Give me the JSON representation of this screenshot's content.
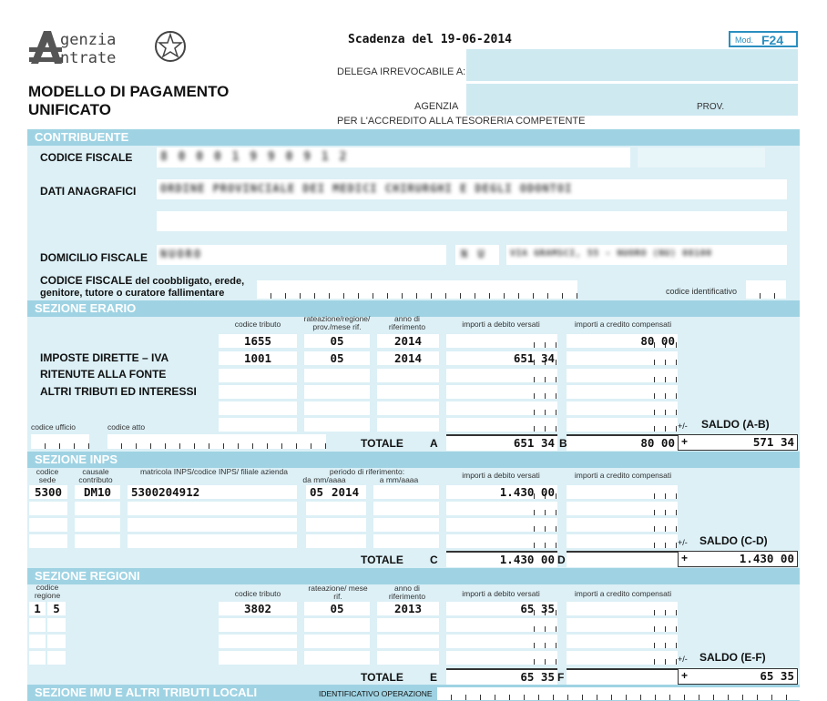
{
  "header": {
    "logo_line1": "genzia",
    "logo_line2": "ntrate",
    "scadenza": "Scadenza del 19-06-2014",
    "mod_label": "Mod.",
    "mod_code": "F24",
    "title_line1": "MODELLO DI PAGAMENTO",
    "title_line2": "UNIFICATO",
    "delega_label": "DELEGA IRREVOCABILE A:",
    "agenzia_label": "AGENZIA",
    "prov_label": "PROV.",
    "accredito_label": "PER L'ACCREDITO ALLA TESORERIA COMPETENTE"
  },
  "contribuente": {
    "band": "CONTRIBUENTE",
    "codice_fiscale_label": "CODICE FISCALE",
    "codice_fiscale_value": "8 0 0 0 1 9 9 0 9 1 2",
    "dati_anagrafici_label": "DATI ANAGRAFICI",
    "ragione_sociale": "ORDINE PROVINCIALE DEI MEDICI CHIRURGHI E DEGLI ODONTOI",
    "domicilio_label": "DOMICILIO FISCALE",
    "comune": "NUORO",
    "provincia": "N U",
    "indirizzo": "VIA GRAMSCI, 55 - NUORO (NU) 08100",
    "coobbligato_label_bold": "CODICE FISCALE",
    "coobbligato_label_rest": " del coobbligato, erede,",
    "coobbligato_label_line2": "genitore, tutore o curatore fallimentare",
    "codice_identificativo": "codice identificativo"
  },
  "erario": {
    "band": "SEZIONE ERARIO",
    "headers": {
      "codice_tributo": "codice tributo",
      "rateazione": "rateazione/regione/ prov./mese rif.",
      "anno": "anno di riferimento",
      "debito": "importi a debito versati",
      "credito": "importi a credito compensati"
    },
    "left_labels": [
      "IMPOSTE DIRETTE – IVA",
      "RITENUTE ALLA FONTE",
      "ALTRI TRIBUTI ED INTERESSI"
    ],
    "rows": [
      {
        "codice": "1655",
        "rateazione": "05",
        "anno": "2014",
        "debito": "",
        "credito": "80 00"
      },
      {
        "codice": "1001",
        "rateazione": "05",
        "anno": "2014",
        "debito": "651 34",
        "credito": ""
      }
    ],
    "codice_ufficio": "codice ufficio",
    "codice_atto": "codice atto",
    "totale_label": "TOTALE",
    "totale_a_letter": "A",
    "totale_a": "651 34",
    "totale_b_letter": "B",
    "totale_b": "80 00",
    "saldo_label": "SALDO (A-B)",
    "saldo": "571 34"
  },
  "inps": {
    "band": "SEZIONE INPS",
    "headers": {
      "codice_sede": "codice sede",
      "causale": "causale contributo",
      "matricola": "matricola INPS/codice INPS/ filiale azienda",
      "periodo": "periodo di riferimento:",
      "da": "da mm/aaaa",
      "a": "a mm/aaaa",
      "debito": "importi a debito versati",
      "credito": "importi a credito compensati"
    },
    "row": {
      "sede": "5300",
      "causale": "DM10",
      "matricola": "5300204912",
      "da_mm": "05",
      "da_aaaa": "2014",
      "debito": "1.430 00"
    },
    "totale_label": "TOTALE",
    "totale_c_letter": "C",
    "totale_c": "1.430 00",
    "totale_d_letter": "D",
    "saldo_label": "SALDO (C-D)",
    "saldo": "1.430 00"
  },
  "regioni": {
    "band": "SEZIONE REGIONI",
    "headers": {
      "codice_regione": "codice regione",
      "codice_tributo": "codice tributo",
      "rateazione": "rateazione/ mese rif.",
      "anno": "anno di riferimento",
      "debito": "importi a debito versati",
      "credito": "importi a credito compensati"
    },
    "row": {
      "regione1": "1",
      "regione2": "5",
      "codice": "3802",
      "rateazione": "05",
      "anno": "2013",
      "debito": "65 35"
    },
    "totale_label": "TOTALE",
    "totale_e_letter": "E",
    "totale_e": "65 35",
    "totale_f_letter": "F",
    "saldo_label": "SALDO (E-F)",
    "saldo": "65 35"
  },
  "imu": {
    "band": "SEZIONE IMU E ALTRI TRIBUTI LOCALI",
    "identificativo": "IDENTIFICATIVO OPERAZIONE"
  },
  "colors": {
    "band": "#9fd3e3",
    "section": "#dcf0f6",
    "mod_blue": "#2a8fc0"
  }
}
